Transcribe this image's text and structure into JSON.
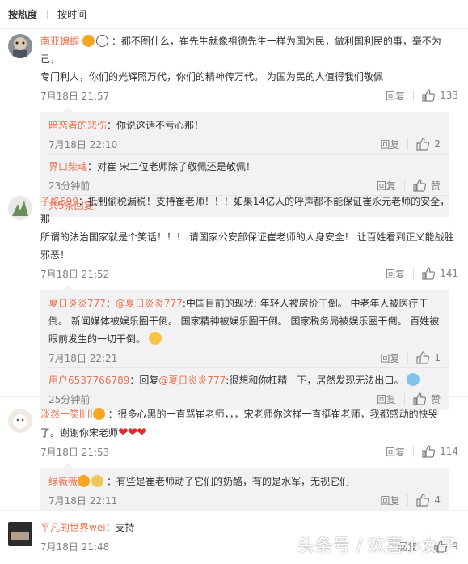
{
  "sort": {
    "hot": "按热度",
    "time": "按时间"
  },
  "comments": [
    {
      "user": "南亚蝙蝠",
      "text1": "：都不图什么，崔先生就像祖德先生一样为国为民，做利国利民的事，毫不为己，",
      "text2": "专门利人，你们的光辉照万代，你们的精神传万代。  为国为民的人值得我们敬佩",
      "time": "7月18日 21:57",
      "reply_label": "回复",
      "likes": "133",
      "replies": [
        {
          "user": "暗恋者的悲伤",
          "text": "：你说这话不亏心那！",
          "time": "7月18日 22:10",
          "reply_label": "回复",
          "likes": "2"
        },
        {
          "user": "界口柴魂",
          "text": "：对崔 宋二位老师除了敬佩还是敬佩！",
          "time": "23分钟前",
          "reply_label": "回复",
          "likes": "赞"
        }
      ],
      "more_replies": "共5条回复"
    },
    {
      "user": "子焰699",
      "text1": "：抵制偷税漏税！支持崔老师！！！如果14亿人的呼声都不能保证崔永元老师的安全，那",
      "text2": "所谓的法治国家就是个笑话！！！ 请国家公安部保证崔老师的人身安全！ 让百姓看到正义能战胜",
      "text3": "邪恶！",
      "time": "7月18日 21:52",
      "reply_label": "回复",
      "likes": "141",
      "replies": [
        {
          "user": "夏日炎炎777",
          "mention": "@夏日炎炎777",
          "text1": ":中国目前的现状:   年轻人被房价干倒。   中老年人被医疗干",
          "text2": "倒。   新闻媒体被娱乐圈干倒。   国家精神被娱乐圈干倒。   国家税务局被娱乐圈干倒。   百姓被",
          "text3": "眼前发生的一切干倒。",
          "time": "7月18日 22:21",
          "reply_label": "回复",
          "likes": "1"
        },
        {
          "user": "用户6537766789",
          "prefix": "：回复",
          "mention": "@夏日炎炎777",
          "text": ":很想和你杠精一下，居然发现无法出口。",
          "time": "25分钟前",
          "reply_label": "回复",
          "likes": "赞"
        }
      ]
    },
    {
      "user": "淡然一笑lllll",
      "text1": "：很多心黑的一直骂崔老师，，，宋老师你这样一直挺崔老师，我都感动的快哭",
      "text2": "了。谢谢你宋老师",
      "hearts": "❤❤❤",
      "time": "7月18日 21:53",
      "reply_label": "回复",
      "likes": "114",
      "replies": [
        {
          "user": "绿薇薇",
          "text": "：有些是崔老师动了它们的奶酪，有的是水军，无视它们",
          "time": "7月18日 22:11",
          "reply_label": "回复",
          "likes": "4"
        }
      ]
    },
    {
      "user": "平凡的世界wei",
      "text": "：支持",
      "time": "7月18日 21:48",
      "reply_label": "回复",
      "likes": "9"
    }
  ],
  "watermark": "头条号 / 欢喜小女子",
  "colors": {
    "username": "#eb7350",
    "meta": "#808080",
    "reply_bg": "#f2f2f5"
  }
}
